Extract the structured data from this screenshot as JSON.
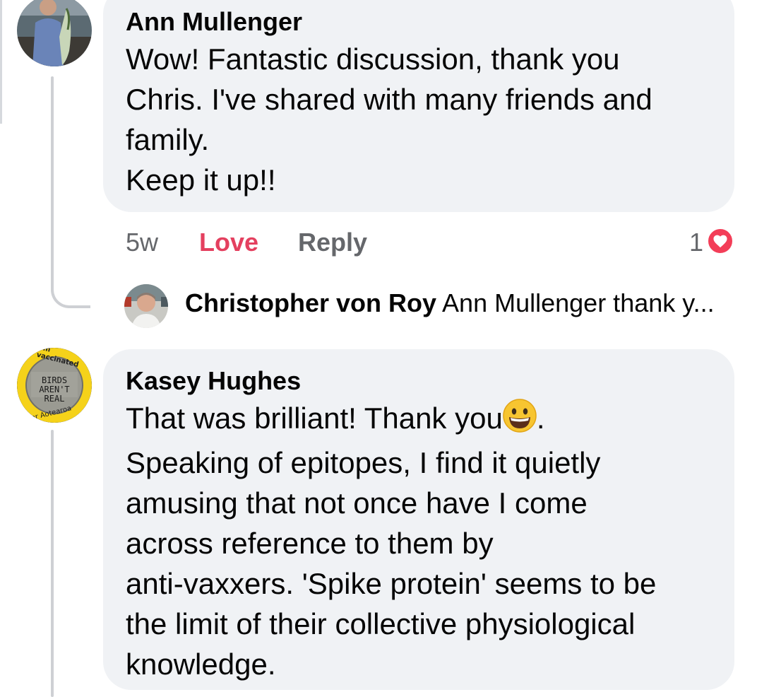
{
  "comments": [
    {
      "author": "Ann Mullenger",
      "lines": [
        "Wow! Fantastic discussion,  thank you",
        "Chris. I've shared with many friends and",
        "family.",
        "Keep it up!!"
      ],
      "time": "5w",
      "love_label": "Love",
      "reply_label": "Reply",
      "reaction_count": "1",
      "reaction_icon": "heart-icon",
      "reply_preview": {
        "author": "Christopher von Roy",
        "text": "Ann Mullenger thank y..."
      }
    },
    {
      "author": "Kasey Hughes",
      "lines": [
        "That was brilliant! Thank you",
        "Speaking of epitopes, I find it quietly",
        "amusing that not once have I come",
        "across reference to them by",
        "anti-vaxxers. 'Spike protein' seems to be",
        "the limit of their collective physiological",
        "knowledge."
      ],
      "line1_suffix": ".",
      "line1_emoji": "grinning-face-emoji",
      "avatar_badge": {
        "top": "I'm vaccinated",
        "middle": [
          "BIRDS",
          "AREN'T",
          "REAL"
        ],
        "bottom": "For Aotearoa"
      }
    }
  ],
  "colors": {
    "bubble": "#f0f2f5",
    "love": "#e4405f",
    "meta": "#65676b",
    "badge_yellow": "#f5d21a"
  }
}
